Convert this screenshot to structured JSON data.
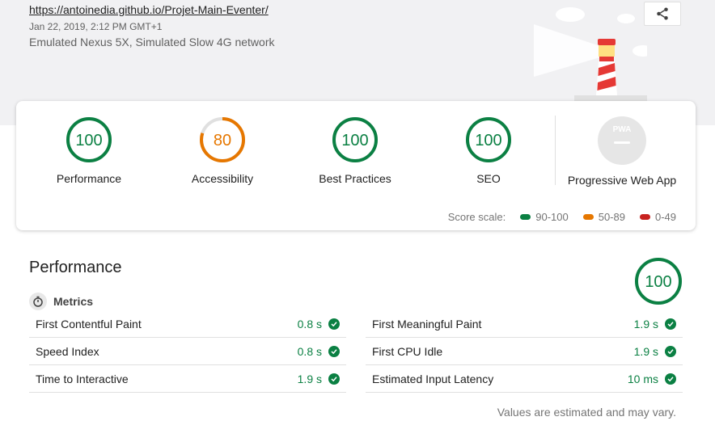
{
  "header": {
    "url": "https://antoinedia.github.io/Projet-Main-Eventer/",
    "date": "Jan 22, 2019, 2:12 PM GMT+1",
    "environment": "Emulated Nexus 5X, Simulated Slow 4G network"
  },
  "summary": {
    "gauges": [
      {
        "score": "100",
        "label": "Performance",
        "color": "#0b8043",
        "fraction": 1.0
      },
      {
        "score": "80",
        "label": "Accessibility",
        "color": "#e67700",
        "fraction": 0.8
      },
      {
        "score": "100",
        "label": "Best Practices",
        "color": "#0b8043",
        "fraction": 1.0
      },
      {
        "score": "100",
        "label": "SEO",
        "color": "#0b8043",
        "fraction": 1.0
      }
    ],
    "pwa": {
      "label": "Progressive Web App",
      "badge": "PWA"
    },
    "scale": {
      "label": "Score scale:",
      "ranges": [
        {
          "text": "90-100",
          "color": "#0b8043"
        },
        {
          "text": "50-89",
          "color": "#e67700"
        },
        {
          "text": "0-49",
          "color": "#c7221f"
        }
      ]
    }
  },
  "performance": {
    "title": "Performance",
    "score": "100",
    "metrics_label": "Metrics",
    "left": [
      {
        "name": "First Contentful Paint",
        "value": "0.8 s"
      },
      {
        "name": "Speed Index",
        "value": "0.8 s"
      },
      {
        "name": "Time to Interactive",
        "value": "1.9 s"
      }
    ],
    "right": [
      {
        "name": "First Meaningful Paint",
        "value": "1.9 s"
      },
      {
        "name": "First CPU Idle",
        "value": "1.9 s"
      },
      {
        "name": "Estimated Input Latency",
        "value": "10 ms"
      }
    ],
    "note": "Values are estimated and may vary."
  },
  "colors": {
    "pass": "#0b8043",
    "average": "#e67700",
    "fail": "#c7221f"
  }
}
